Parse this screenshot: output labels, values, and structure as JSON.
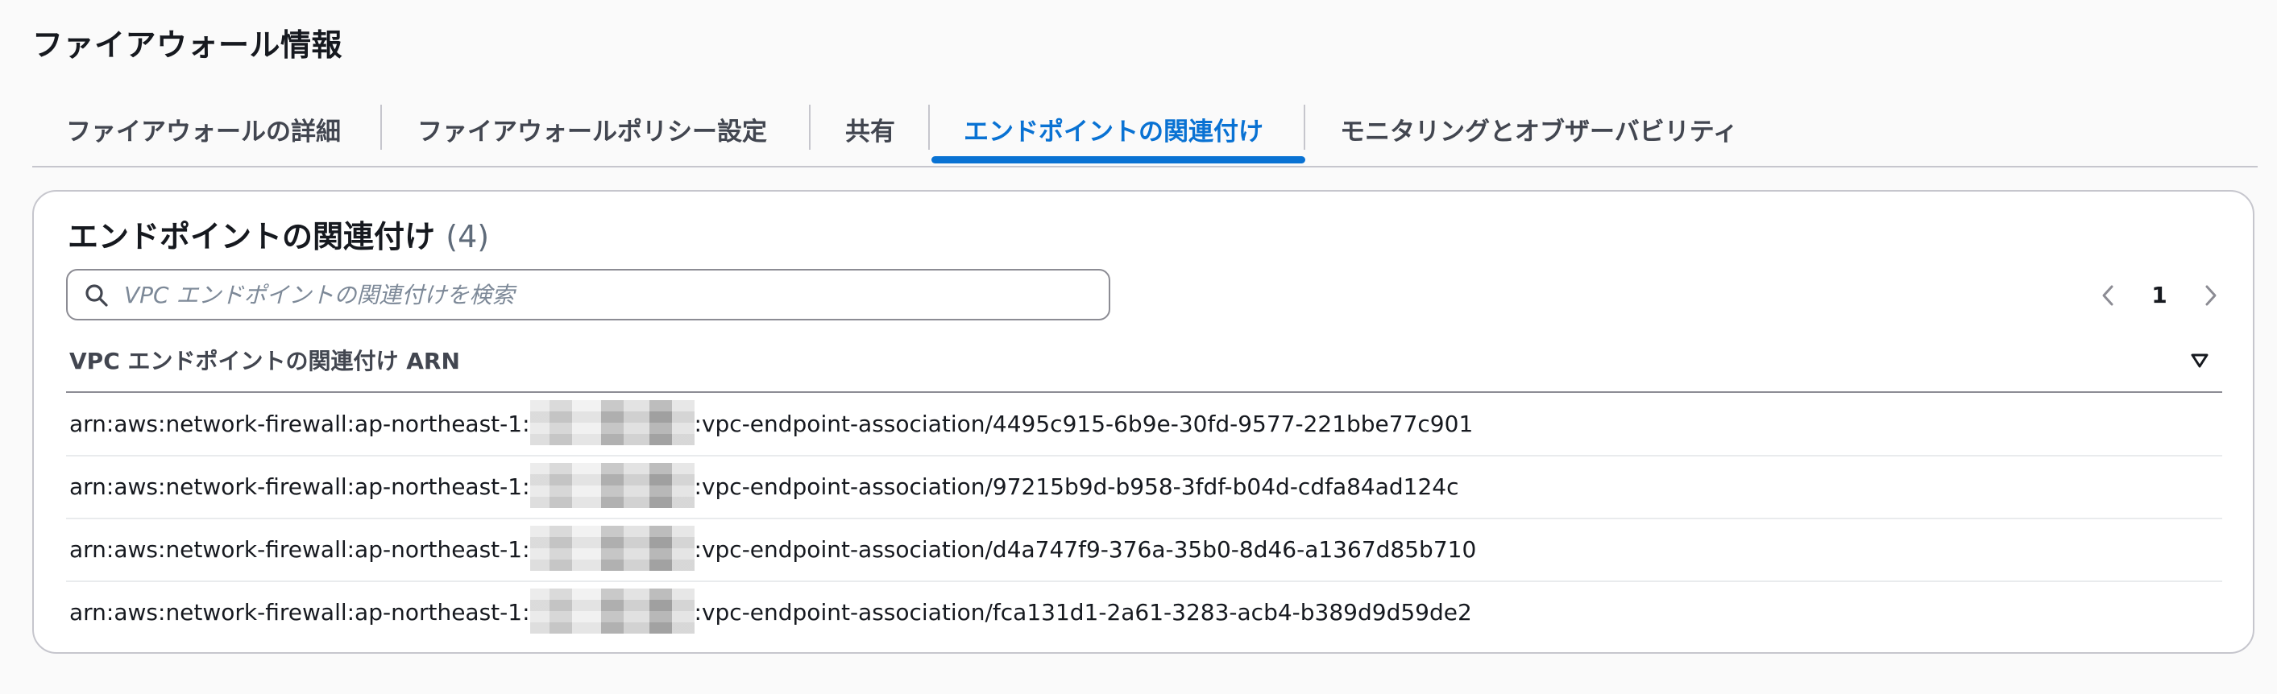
{
  "page": {
    "title": "ファイアウォール情報"
  },
  "tabs": [
    {
      "label": "ファイアウォールの詳細",
      "active": false
    },
    {
      "label": "ファイアウォールポリシー設定",
      "active": false
    },
    {
      "label": "共有",
      "active": false
    },
    {
      "label": "エンドポイントの関連付け",
      "active": true
    },
    {
      "label": "モニタリングとオブザーバビリティ",
      "active": false
    }
  ],
  "panel": {
    "title": "エンドポイントの関連付け",
    "count": "(4)",
    "search": {
      "placeholder": "VPC エンドポイントの関連付けを検索",
      "value": ""
    },
    "pagination": {
      "current_page": "1"
    },
    "table": {
      "column_header": "VPC エンドポイントの関連付け ARN",
      "rows": [
        {
          "arn_prefix": "arn:aws:network-firewall:ap-northeast-1:",
          "arn_suffix": ":vpc-endpoint-association/4495c915-6b9e-30fd-9577-221bbe77c901"
        },
        {
          "arn_prefix": "arn:aws:network-firewall:ap-northeast-1:",
          "arn_suffix": ":vpc-endpoint-association/97215b9d-b958-3fdf-b04d-cdfa84ad124c"
        },
        {
          "arn_prefix": "arn:aws:network-firewall:ap-northeast-1:",
          "arn_suffix": ":vpc-endpoint-association/d4a747f9-376a-35b0-8d46-a1367d85b710"
        },
        {
          "arn_prefix": "arn:aws:network-firewall:ap-northeast-1:",
          "arn_suffix": ":vpc-endpoint-association/fca131d1-2a61-3283-acb4-b389d9d59de2"
        }
      ]
    }
  },
  "icons": {
    "search": "search-icon",
    "prev": "chevron-left-icon",
    "next": "chevron-right-icon",
    "sort": "sort-descending-icon"
  },
  "colors": {
    "accent": "#0972d3",
    "text": "#16191f",
    "muted": "#5f6b7a",
    "border": "#c6c6cd"
  }
}
